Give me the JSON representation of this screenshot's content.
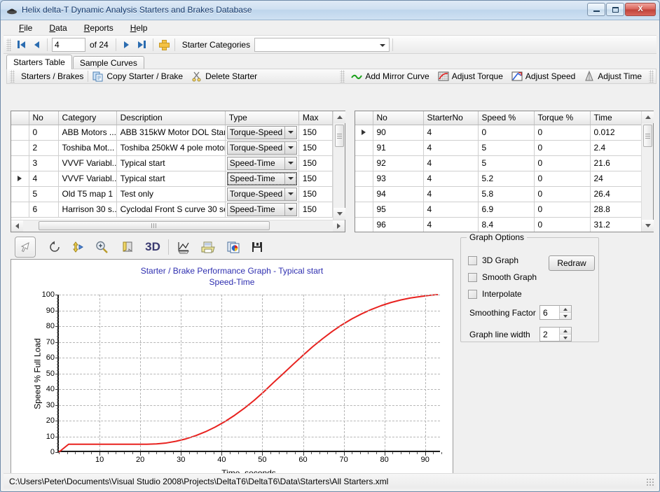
{
  "window": {
    "title": "Helix delta-T Dynamic Analysis Starters and Brakes Database",
    "app_icon": "helix-app-icon",
    "minimize_label": "Minimize",
    "maximize_label": "Maximize",
    "close_label": "X"
  },
  "menubar": {
    "items": [
      {
        "label": "File",
        "accel": "F"
      },
      {
        "label": "Data",
        "accel": "D"
      },
      {
        "label": "Reports",
        "accel": "R"
      },
      {
        "label": "Help",
        "accel": "H"
      }
    ]
  },
  "navbar": {
    "first_icon": "first-record-icon",
    "prev_icon": "previous-record-icon",
    "position_value": "4",
    "count_label": "of 24",
    "next_icon": "next-record-icon",
    "last_icon": "last-record-icon",
    "add_icon": "add-record-icon",
    "category_label": "Starter Categories",
    "category_value": "",
    "category_placeholder": ""
  },
  "tabs": [
    {
      "label": "Starters Table",
      "active": true
    },
    {
      "label": "Sample Curves",
      "active": false
    }
  ],
  "left_toolstrip": {
    "items": [
      {
        "label": "Starters / Brakes",
        "icon": ""
      },
      {
        "label": "Copy Starter / Brake",
        "icon": "copy-icon"
      },
      {
        "label": "Delete Starter",
        "icon": "scissors-icon"
      }
    ]
  },
  "right_toolstrip": {
    "items": [
      {
        "label": "Add Mirror Curve",
        "icon": "mirror-curve-icon"
      },
      {
        "label": "Adjust Torque",
        "icon": "adjust-torque-icon"
      },
      {
        "label": "Adjust Speed",
        "icon": "adjust-speed-icon"
      },
      {
        "label": "Adjust Time",
        "icon": "adjust-time-icon"
      }
    ]
  },
  "starters_grid": {
    "columns": [
      "",
      "No",
      "Category",
      "Description",
      "Type",
      "Max"
    ],
    "rows": [
      {
        "marker": "",
        "no": "0",
        "category": "ABB Motors ...",
        "description": "ABB 315kW Motor DOL Star...",
        "type": "Torque-Speed",
        "max": "150",
        "selected": false,
        "focused": false
      },
      {
        "marker": "",
        "no": "2",
        "category": "Toshiba Mot...",
        "description": "Toshiba 250kW 4 pole motor",
        "type": "Torque-Speed",
        "max": "150",
        "selected": false,
        "focused": false
      },
      {
        "marker": "",
        "no": "3",
        "category": "VVVF Variabl...",
        "description": "Typical start",
        "type": "Speed-Time",
        "max": "150",
        "selected": false,
        "focused": false
      },
      {
        "marker": "▶",
        "no": "4",
        "category": "VVVF Variabl...",
        "description": "Typical start",
        "type": "Speed-Time",
        "max": "150",
        "selected": true,
        "focused": true
      },
      {
        "marker": "",
        "no": "5",
        "category": "Old T5 map 1",
        "description": "Test only",
        "type": "Torque-Speed",
        "max": "150",
        "selected": false,
        "focused": false
      },
      {
        "marker": "",
        "no": "6",
        "category": "Harrison 30 s...",
        "description": "Cyclodal Front S curve 30 se...",
        "type": "Speed-Time",
        "max": "150",
        "selected": false,
        "focused": false
      }
    ]
  },
  "curve_grid": {
    "columns": [
      "",
      "No",
      "StarterNo",
      "Speed %",
      "Torque %",
      "Time"
    ],
    "rows": [
      {
        "marker": "▶",
        "no": "90",
        "starter_no": "4",
        "speed": "0",
        "torque": "0",
        "time": "0.012",
        "selected": true
      },
      {
        "marker": "",
        "no": "91",
        "starter_no": "4",
        "speed": "5",
        "torque": "0",
        "time": "2.4",
        "selected": false
      },
      {
        "marker": "",
        "no": "92",
        "starter_no": "4",
        "speed": "5",
        "torque": "0",
        "time": "21.6",
        "selected": false
      },
      {
        "marker": "",
        "no": "93",
        "starter_no": "4",
        "speed": "5.2",
        "torque": "0",
        "time": "24",
        "selected": false
      },
      {
        "marker": "",
        "no": "94",
        "starter_no": "4",
        "speed": "5.8",
        "torque": "0",
        "time": "26.4",
        "selected": false
      },
      {
        "marker": "",
        "no": "95",
        "starter_no": "4",
        "speed": "6.9",
        "torque": "0",
        "time": "28.8",
        "selected": false
      },
      {
        "marker": "",
        "no": "96",
        "starter_no": "4",
        "speed": "8.4",
        "torque": "0",
        "time": "31.2",
        "selected": false
      }
    ]
  },
  "graph_toolbar": {
    "buttons": [
      {
        "icon": "select-arrow-icon",
        "pressed": true
      },
      {
        "icon": "rotate-icon",
        "pressed": false
      },
      {
        "icon": "pan-icon",
        "pressed": false
      },
      {
        "icon": "zoom-in-icon",
        "pressed": false
      },
      {
        "icon": "page-curl-icon",
        "pressed": false
      },
      {
        "icon": "3d-label",
        "label": "3D",
        "pressed": false
      },
      {
        "icon": "chart-edit-icon",
        "pressed": false
      },
      {
        "icon": "print-icon",
        "pressed": false
      },
      {
        "icon": "copy-chart-icon",
        "pressed": false
      },
      {
        "icon": "save-icon",
        "pressed": false
      }
    ]
  },
  "graph_options": {
    "legend": "Graph Options",
    "checkboxes": [
      {
        "label": "3D Graph",
        "checked": false
      },
      {
        "label": "Smooth Graph",
        "checked": false
      },
      {
        "label": "Interpolate",
        "checked": false
      }
    ],
    "redraw_label": "Redraw",
    "spinners": [
      {
        "label": "Smoothing Factor",
        "value": "6"
      },
      {
        "label": "Graph line width",
        "value": "2"
      }
    ]
  },
  "statusbar": {
    "path": "C:\\Users\\Peter\\Documents\\Visual Studio 2008\\Projects\\DeltaT6\\DeltaT6\\Data\\Starters\\All Starters.xml"
  },
  "colors": {
    "curve": "#e8221f",
    "title": "#2f2fb0",
    "selection": "#2a8bf2",
    "accent": "#2b6cb0"
  },
  "chart_data": {
    "type": "line",
    "title": "Starter / Brake Performance Graph - Typical start",
    "subtitle": "Speed-Time",
    "xlabel": "Time, seconds",
    "ylabel": "Speed % Full Load",
    "xlim": [
      0,
      94
    ],
    "ylim": [
      0,
      100
    ],
    "xticks": [
      10,
      20,
      30,
      40,
      50,
      60,
      70,
      80,
      90
    ],
    "yticks": [
      0,
      10,
      20,
      30,
      40,
      50,
      60,
      70,
      80,
      90,
      100
    ],
    "grid": true,
    "legend": "none",
    "series": [
      {
        "name": "Speed-Time",
        "color": "#e8221f",
        "line_width": 2,
        "x": [
          0.012,
          2.4,
          21.6,
          24,
          26.4,
          28.8,
          31.2,
          33.6,
          36,
          38.4,
          40.8,
          43.2,
          45.6,
          48,
          50.4,
          52.8,
          55.2,
          57.6,
          60,
          62.4,
          64.8,
          67.2,
          69.6,
          72,
          74.4,
          76.8,
          79.2,
          81.6,
          84,
          86.4,
          88.8,
          91.2,
          93
        ],
        "y": [
          0,
          5,
          5,
          5.2,
          5.8,
          6.9,
          8.4,
          10.4,
          12.9,
          15.9,
          19.4,
          23.4,
          27.9,
          32.9,
          38.4,
          44.3,
          50.0,
          55.8,
          61.5,
          67.0,
          72.0,
          76.7,
          80.9,
          84.6,
          87.8,
          90.6,
          93.0,
          95.0,
          96.6,
          97.9,
          98.8,
          99.6,
          100
        ]
      }
    ]
  }
}
